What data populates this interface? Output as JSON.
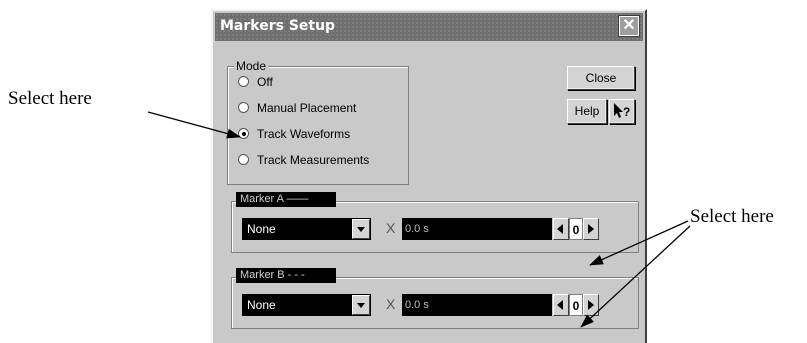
{
  "callouts": {
    "left": "Select here",
    "right": "Select here"
  },
  "dialog": {
    "title": "Markers Setup",
    "close_icon": "close-icon",
    "mode": {
      "label": "Mode",
      "options": [
        {
          "label": "Off",
          "selected": false
        },
        {
          "label": "Manual Placement",
          "selected": false
        },
        {
          "label": "Track Waveforms",
          "selected": true
        },
        {
          "label": "Track Measurements",
          "selected": false
        }
      ]
    },
    "buttons": {
      "close": "Close",
      "help": "Help",
      "whats_this_icon": "help-pointer-icon"
    },
    "marker_a": {
      "label": "Marker A ——",
      "select_value": "None",
      "x_label": "X",
      "position_value": "0.0 s",
      "spin_value": "0"
    },
    "marker_b": {
      "label": "Marker B - - -",
      "select_value": "None",
      "x_label": "X",
      "position_value": "0.0 s",
      "spin_value": "0"
    }
  }
}
